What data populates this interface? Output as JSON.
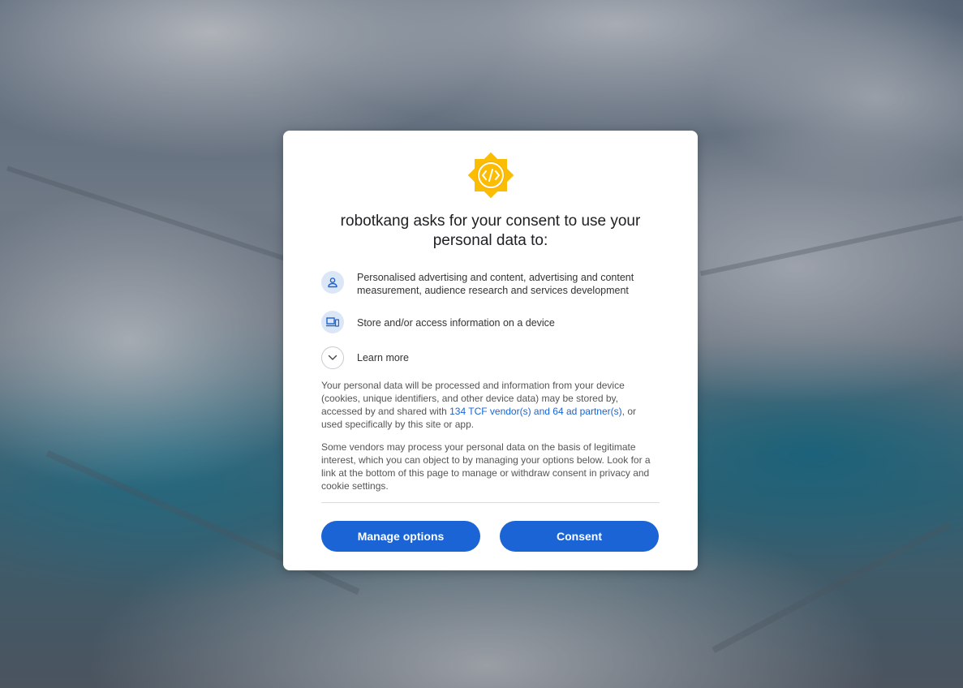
{
  "dialog": {
    "title": "robotkang asks for your consent to use your personal data to:",
    "purposes": [
      {
        "icon": "person-icon",
        "text": "Personalised advertising and content, advertising and content measurement, audience research and services development"
      },
      {
        "icon": "devices-icon",
        "text": "Store and/or access information on a device"
      }
    ],
    "learn_more": "Learn more",
    "para1_before": "Your personal data will be processed and information from your device (cookies, unique identifiers, and other device data) may be stored by, accessed by and shared with ",
    "para1_link": "134 TCF vendor(s) and 64 ad partner(s)",
    "para1_after": ", or used specifically by this site or app.",
    "para2": "Some vendors may process your personal data on the basis of legitimate interest, which you can object to by managing your options below. Look for a link at the bottom of this page to manage or withdraw consent in privacy and cookie settings.",
    "manage_label": "Manage options",
    "consent_label": "Consent"
  },
  "colors": {
    "accent": "#1a64d6",
    "icon_bg": "#dbe6f7",
    "logo_yellow": "#fbbc04"
  }
}
